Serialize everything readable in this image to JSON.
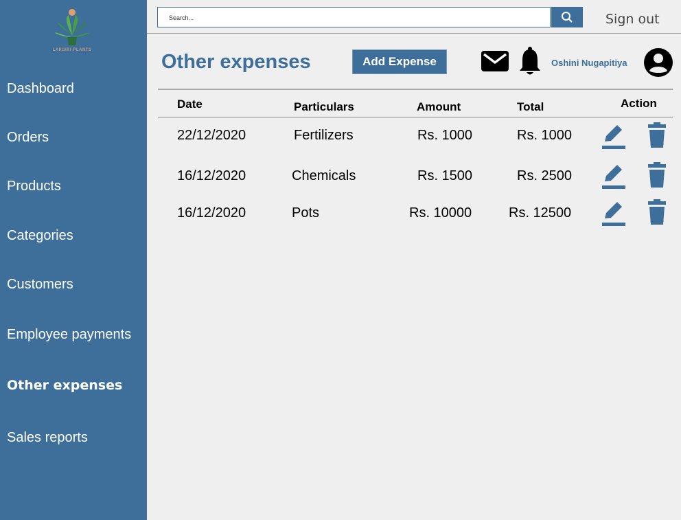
{
  "brand": {
    "logo_text": "LAKSIRI PLANTS"
  },
  "sidebar": {
    "items": [
      {
        "label": "Dashboard"
      },
      {
        "label": "Orders"
      },
      {
        "label": "Products"
      },
      {
        "label": "Categories"
      },
      {
        "label": "Customers"
      },
      {
        "label": "Employee payments"
      },
      {
        "label": "Other expenses",
        "active": true
      },
      {
        "label": "Sales reports"
      }
    ]
  },
  "topbar": {
    "search_placeholder": "Search...",
    "search_icon": "search-icon",
    "signout_label": "Sign out"
  },
  "header": {
    "title": "Other expenses",
    "add_button": "Add Expense",
    "user_name": "Oshini Nugapitiya",
    "icons": [
      "mail-icon",
      "bell-icon",
      "user-avatar-icon"
    ]
  },
  "table": {
    "columns": [
      "Date",
      "Particulars",
      "Amount",
      "Total",
      "Action"
    ],
    "rows": [
      {
        "date": "22/12/2020",
        "particulars": "Fertilizers",
        "amount": "Rs. 1000",
        "total": "Rs. 1000"
      },
      {
        "date": "16/12/2020",
        "particulars": "Chemicals",
        "amount": "Rs. 1500",
        "total": "Rs. 2500"
      },
      {
        "date": "16/12/2020",
        "particulars": "Pots",
        "amount": "Rs. 10000",
        "total": "Rs. 12500"
      }
    ]
  },
  "colors": {
    "accent": "#3d6f9a",
    "background": "#efefef"
  }
}
